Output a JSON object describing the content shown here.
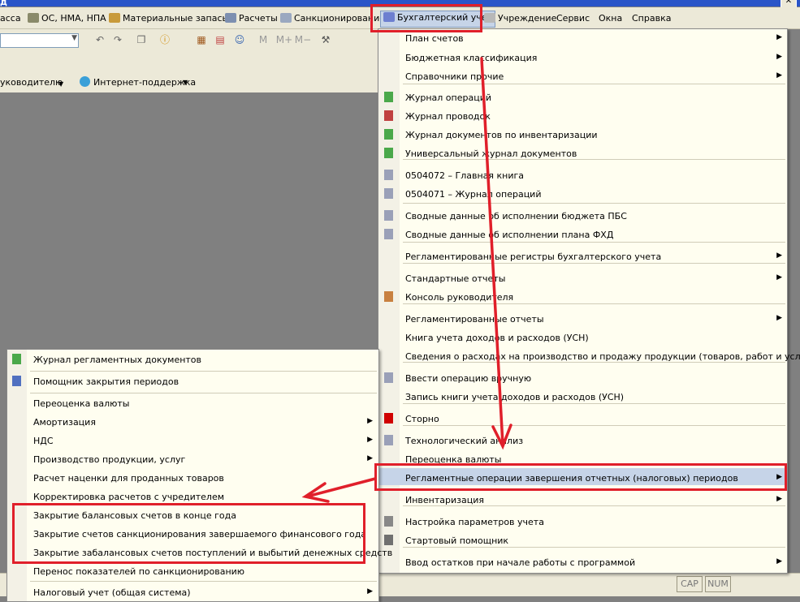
{
  "window": {
    "title": "д"
  },
  "menubar": {
    "items": [
      "асса",
      "ОС, НМА, НПА",
      "Материальные запасы",
      "Расчеты",
      "Санкционирование",
      "Бухгалтерский учет",
      "Учреждение",
      "Сервис",
      "Окна",
      "Справка"
    ]
  },
  "toolbar": {
    "labels": {
      "m": "M",
      "m_plus": "M+",
      "m_minus": "M−"
    },
    "links": {
      "rukovoditel": "уководителю",
      "internet": "Интернет-поддержка"
    }
  },
  "right_menu": {
    "items": [
      "План счетов",
      "Бюджетная классификация",
      "Справочники прочие",
      "Журнал операций",
      "Журнал проводок",
      "Журнал документов по инвентаризации",
      "Универсальный журнал документов",
      "0504072  –  Главная книга",
      "0504071  –  Журнал операций",
      "Сводные данные об исполнении бюджета ПБС",
      "Сводные данные об исполнении плана ФХД",
      "Регламентированные регистры бухгалтерского учета",
      "Стандартные отчеты",
      "Консоль руководителя",
      "Регламентированные отчеты",
      "Книга учета доходов и расходов (УСН)",
      "Сведения о расходах на производство и продажу продукции (товаров, работ и услуг)",
      "Ввести операцию вручную",
      "Запись книги учета доходов и расходов (УСН)",
      "Сторно",
      "Технологический анализ",
      "Переоценка валюты",
      "Регламентные операции завершения отчетных (налоговых) периодов",
      "Инвентаризация",
      "Настройка параметров учета",
      "Стартовый помощник",
      "Ввод остатков при начале работы с программой"
    ]
  },
  "left_menu": {
    "items": [
      "Журнал регламентных документов",
      "Помощник закрытия периодов",
      "Переоценка валюты",
      "Амортизация",
      "НДС",
      "Производство продукции, услуг",
      "Расчет наценки для проданных товаров",
      "Корректировка расчетов с учредителем",
      "Закрытие балансовых счетов в конце года",
      "Закрытие счетов санкционирования завершаемого финансового года",
      "Закрытие забалансовых счетов поступлений и выбытий денежных средств",
      "Перенос показателей по санкционированию",
      "Налоговый учет (общая система)"
    ]
  },
  "statusbar": {
    "cap": "CAP",
    "num": "NUM"
  },
  "colors": {
    "highlight": "#c6d4e8",
    "annotation_red": "#e01f2a",
    "menu_bg": "#fffef0"
  }
}
